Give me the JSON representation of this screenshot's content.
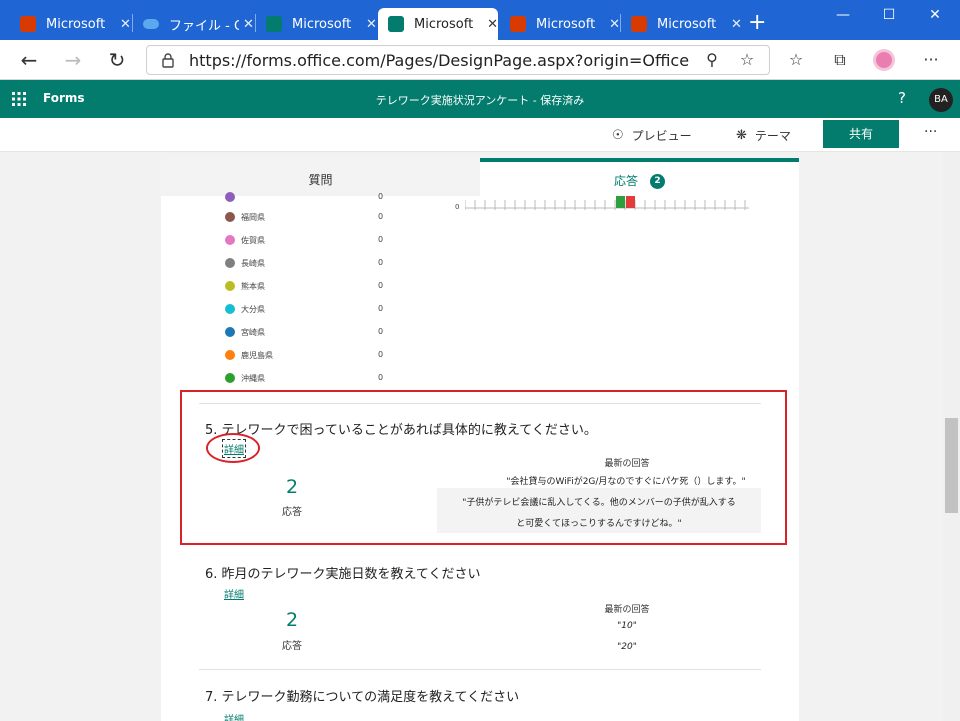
{
  "browser": {
    "tabs": [
      {
        "label": "Microsoft",
        "icon": "office-icon",
        "color": "#d83b01",
        "active": false
      },
      {
        "label": "ファイル - O",
        "icon": "onedrive-icon",
        "color": "#0f6fc6",
        "active": false
      },
      {
        "label": "Microsoft",
        "icon": "forms-icon",
        "color": "#037c6d",
        "active": false
      },
      {
        "label": "Microsoft",
        "icon": "forms-icon",
        "color": "#037c6d",
        "active": true
      },
      {
        "label": "Microsoft",
        "icon": "office-icon",
        "color": "#d83b01",
        "active": false
      },
      {
        "label": "Microsoft",
        "icon": "office-icon",
        "color": "#d83b01",
        "active": false
      }
    ],
    "url": "https://forms.office.com/Pages/DesignPage.aspx?origin=OfficeDotC...",
    "window_controls": {
      "minimize": "—",
      "maximize": "☐",
      "close": "✕"
    }
  },
  "forms_header": {
    "brand": "Forms",
    "title": "テレワーク実施状況アンケート - 保存済み",
    "help": "?",
    "avatar": "BA"
  },
  "command_bar": {
    "preview": "プレビュー",
    "theme": "テーマ",
    "share": "共有",
    "more": "···"
  },
  "tabs": {
    "questions": "質問",
    "responses": "応答",
    "responses_count": "2"
  },
  "q4_chart": {
    "axis_zero": "0",
    "bar_colors": [
      "#2e9e3e",
      "#e23b3b"
    ]
  },
  "legend": [
    {
      "label": "",
      "value": "0",
      "color": "#8e5fb8"
    },
    {
      "label": "福岡県",
      "value": "0",
      "color": "#8c564b"
    },
    {
      "label": "佐賀県",
      "value": "0",
      "color": "#e377c2"
    },
    {
      "label": "長崎県",
      "value": "0",
      "color": "#7f7f7f"
    },
    {
      "label": "熊本県",
      "value": "0",
      "color": "#bcbd22"
    },
    {
      "label": "大分県",
      "value": "0",
      "color": "#17becf"
    },
    {
      "label": "宮崎県",
      "value": "0",
      "color": "#1f77b4"
    },
    {
      "label": "鹿児島県",
      "value": "0",
      "color": "#ff7f0e"
    },
    {
      "label": "沖縄県",
      "value": "0",
      "color": "#2ca02c"
    }
  ],
  "q5": {
    "title": "5. テレワークで困っていることがあれば具体的に教えてください。",
    "detail": "詳細",
    "count": "2",
    "count_label": "応答",
    "latest_header": "最新の回答",
    "responses": [
      "\"会社貸与のWiFiが2G/月なのですぐにパケ死（）します。\"",
      "\"子供がテレビ会議に乱入してくる。他のメンバーの子供が乱入する",
      "と可愛くてほっこりするんですけどね。\""
    ]
  },
  "q6": {
    "title": "6. 昨月のテレワーク実施日数を教えてください",
    "detail": "詳細",
    "count": "2",
    "count_label": "応答",
    "latest_header": "最新の回答",
    "responses": [
      "\"10\"",
      "\"20\""
    ]
  },
  "q7": {
    "title": "7. テレワーク勤務についての満足度を教えてください",
    "detail": "詳細"
  }
}
